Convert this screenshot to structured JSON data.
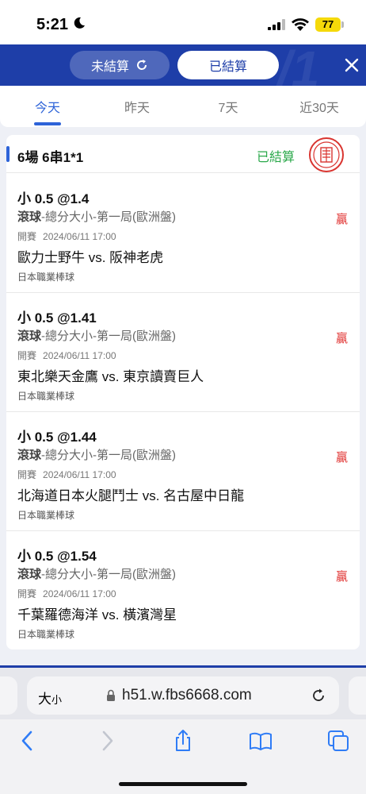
{
  "status_bar": {
    "time": "5:21",
    "battery": "77"
  },
  "header": {
    "unsettled_label": "未結算",
    "settled_label": "已結算",
    "icons": {
      "refresh": "refresh-icon",
      "close": "close-icon"
    }
  },
  "tabs": [
    {
      "label": "今天",
      "active": true
    },
    {
      "label": "昨天",
      "active": false
    },
    {
      "label": "7天",
      "active": false
    },
    {
      "label": "近30天",
      "active": false
    }
  ],
  "card": {
    "title": "6場 6串1*1",
    "status": "已結算"
  },
  "bets": [
    {
      "odds": "小 0.5 @1.4",
      "market_type": "滾球",
      "market_detail": "-總分大小-第一局(歐洲盤)",
      "result": "贏",
      "kickoff_label": "開賽",
      "kickoff": "2024/06/11 17:00",
      "match": "歐力士野牛 vs. 阪神老虎",
      "league": "日本職業棒球"
    },
    {
      "odds": "小 0.5 @1.41",
      "market_type": "滾球",
      "market_detail": "-總分大小-第一局(歐洲盤)",
      "result": "贏",
      "kickoff_label": "開賽",
      "kickoff": "2024/06/11 17:00",
      "match": "東北樂天金鷹 vs. 東京讀賣巨人",
      "league": "日本職業棒球"
    },
    {
      "odds": "小 0.5 @1.44",
      "market_type": "滾球",
      "market_detail": "-總分大小-第一局(歐洲盤)",
      "result": "贏",
      "kickoff_label": "開賽",
      "kickoff": "2024/06/11 17:00",
      "match": "北海道日本火腿鬥士 vs. 名古屋中日龍",
      "league": "日本職業棒球"
    },
    {
      "odds": "小 0.5 @1.54",
      "market_type": "滾球",
      "market_detail": "-總分大小-第一局(歐洲盤)",
      "result": "贏",
      "kickoff_label": "開賽",
      "kickoff": "2024/06/11 17:00",
      "match": "千葉羅德海洋 vs. 橫濱灣星",
      "league": "日本職業棒球"
    }
  ],
  "browser": {
    "aa_label": "大",
    "aa_small": "小",
    "url": "h51.w.fbs6668.com"
  },
  "colors": {
    "brand": "#1e3ea8",
    "accent": "#2d63d8",
    "win": "#e0312f",
    "settled": "#2aa84a"
  }
}
